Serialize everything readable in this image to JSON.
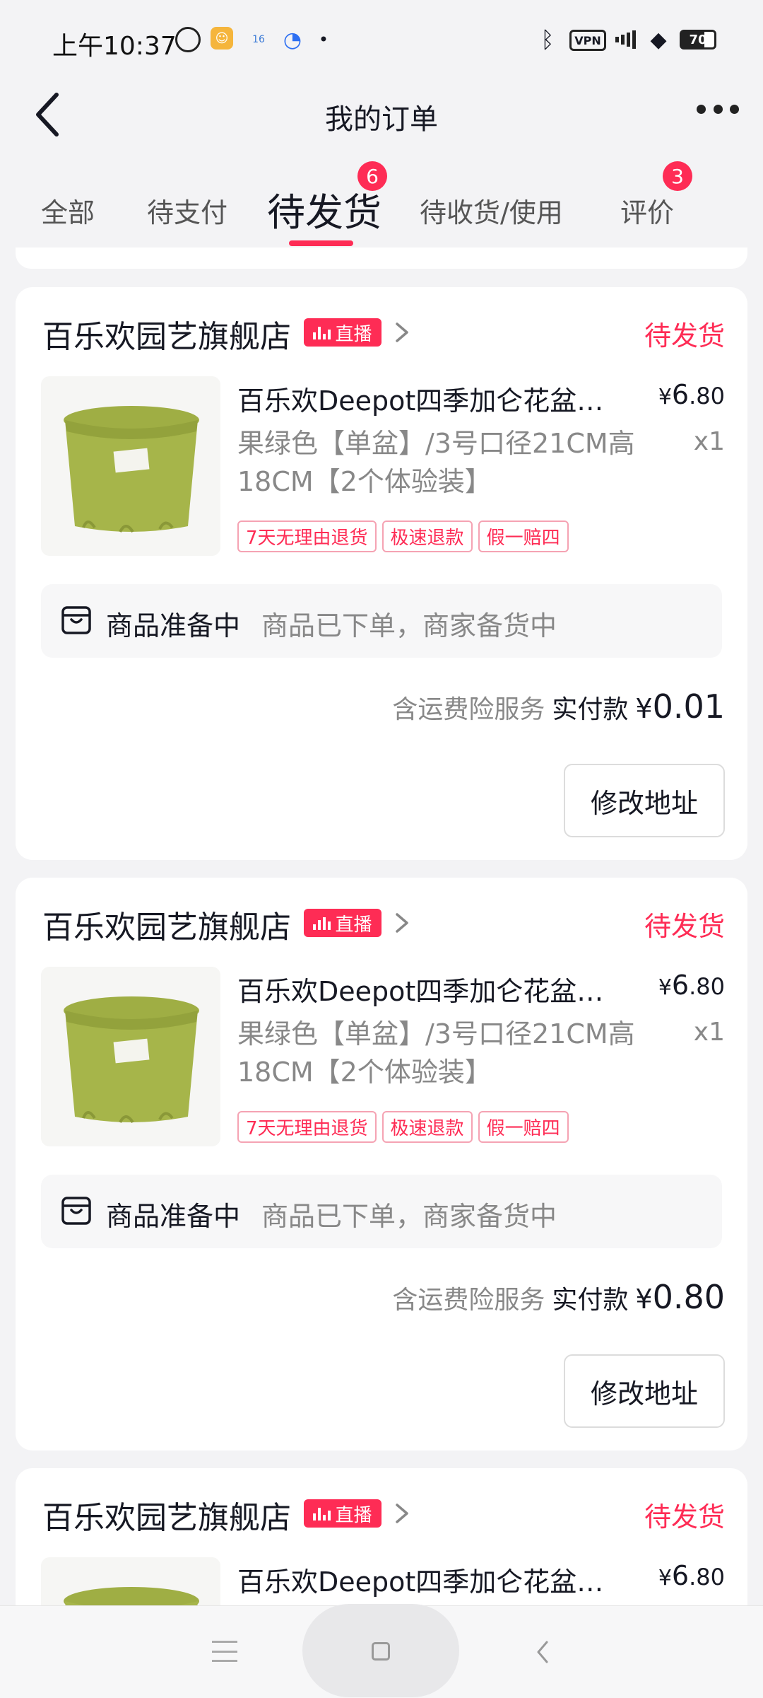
{
  "status_bar": {
    "time": "上午10:37",
    "vpn_label": "VPN",
    "app2_label": "16",
    "battery_label": "70",
    "icons": [
      "alarm-icon",
      "chat-app-icon",
      "calendar-app-icon",
      "browser-app-icon",
      "bluetooth-icon",
      "vpn-icon",
      "signal-icon",
      "wifi-icon",
      "battery-icon"
    ]
  },
  "header": {
    "title": "我的订单"
  },
  "tabs": [
    {
      "label": "全部"
    },
    {
      "label": "待支付"
    },
    {
      "label": "待发货",
      "badge": "6",
      "active": true
    },
    {
      "label": "待收货/使用"
    },
    {
      "label": "评价",
      "badge": "3"
    }
  ],
  "orders": [
    {
      "shop_name": "百乐欢园艺旗舰店",
      "live_label": "直播",
      "status": "待发货",
      "product_title": "百乐欢Deepot四季加仑花盆…",
      "price_symbol": "¥",
      "price_int": "6",
      "price_dec": ".80",
      "spec": "果绿色【单盆】/3号口径21CM高18CM【2个体验装】",
      "qty": "x1",
      "tags": [
        "7天无理由退货",
        "极速退款",
        "假一赔四"
      ],
      "prep_label": "商品准备中",
      "prep_desc": "商品已下单，商家备货中",
      "insurance": "含运费险服务",
      "pay_label": "实付款",
      "pay_symbol": "¥",
      "pay_amount": "0.01",
      "button_label": "修改地址"
    },
    {
      "shop_name": "百乐欢园艺旗舰店",
      "live_label": "直播",
      "status": "待发货",
      "product_title": "百乐欢Deepot四季加仑花盆…",
      "price_symbol": "¥",
      "price_int": "6",
      "price_dec": ".80",
      "spec": "果绿色【单盆】/3号口径21CM高18CM【2个体验装】",
      "qty": "x1",
      "tags": [
        "7天无理由退货",
        "极速退款",
        "假一赔四"
      ],
      "prep_label": "商品准备中",
      "prep_desc": "商品已下单，商家备货中",
      "insurance": "含运费险服务",
      "pay_label": "实付款",
      "pay_symbol": "¥",
      "pay_amount": "0.80",
      "button_label": "修改地址"
    },
    {
      "shop_name": "百乐欢园艺旗舰店",
      "live_label": "直播",
      "status": "待发货",
      "product_title": "百乐欢Deepot四季加仑花盆…",
      "price_symbol": "¥",
      "price_int": "6",
      "price_dec": ".80"
    }
  ],
  "colors": {
    "accent": "#fe2c55",
    "pot_green": "#a6b54a",
    "background": "#f3f3f5"
  }
}
